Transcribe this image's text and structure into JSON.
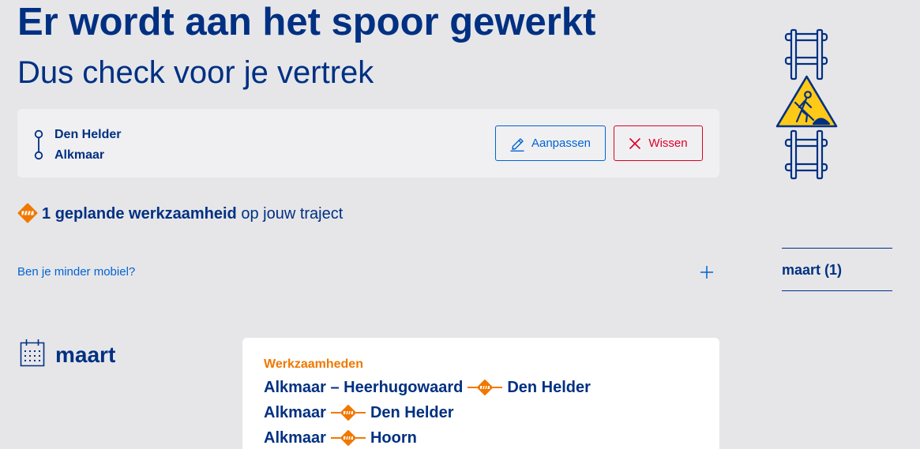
{
  "header": {
    "title": "Er wordt aan het spoor gewerkt",
    "subtitle": "Dus check voor je vertrek"
  },
  "route": {
    "from": "Den Helder",
    "to": "Alkmaar",
    "edit_label": "Aanpassen",
    "clear_label": "Wissen"
  },
  "summary": {
    "count": 1,
    "count_label": "geplande werkzaamheid",
    "suffix": "op jouw traject"
  },
  "accessibility": {
    "label": "Ben je minder mobiel?",
    "expanded": false
  },
  "month_nav": {
    "items": [
      {
        "label": "maart (1)"
      }
    ]
  },
  "month": {
    "label": "maart",
    "card": {
      "category": "Werkzaamheden",
      "routes": [
        {
          "from": "Alkmaar – Heerhugowaard",
          "to": "Den Helder"
        },
        {
          "from": "Alkmaar",
          "to": "Den Helder"
        },
        {
          "from": "Alkmaar",
          "to": "Hoorn"
        }
      ]
    }
  },
  "icons": {
    "route": "route-icon",
    "edit": "pencil-icon",
    "clear": "close-icon",
    "works": "works-warning-icon",
    "works_connector": "works-connector-icon",
    "expand": "plus-icon",
    "calendar": "calendar-icon",
    "illustration": "track-works-illustration"
  },
  "colors": {
    "brand_blue": "#003082",
    "link_blue": "#0063d3",
    "accent_orange": "#f07800",
    "danger_red": "#db0029",
    "warning_yellow": "#ffc917",
    "page_bg": "#e6e6e9",
    "panel_bg": "#f0f0f2",
    "card_bg": "#ffffff"
  }
}
